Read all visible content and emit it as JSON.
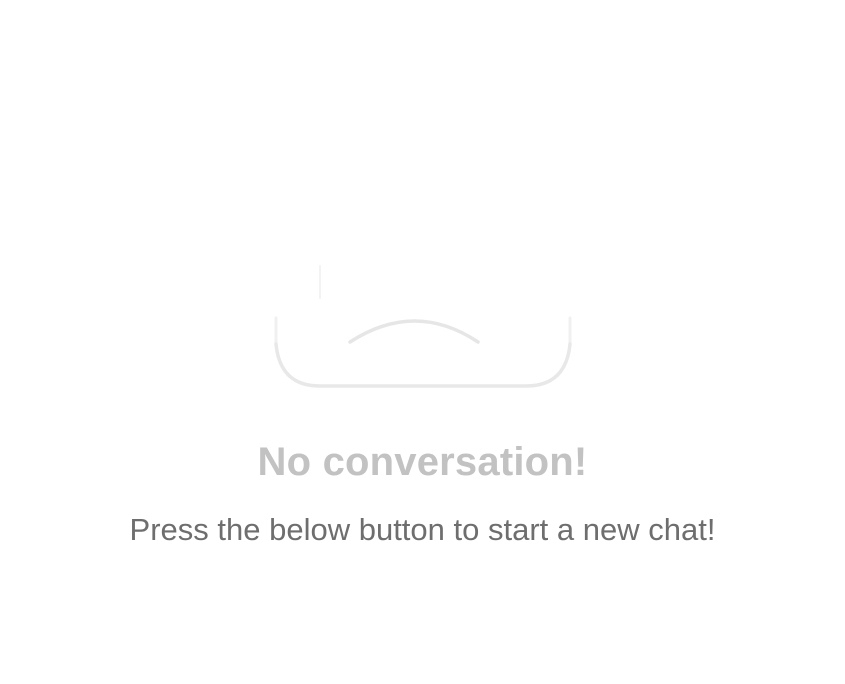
{
  "empty_state": {
    "illustration_icon": "empty-tray-icon",
    "title": "No conversation!",
    "subtitle": "Press the below button to start a new chat!"
  },
  "colors": {
    "background": "#ffffff",
    "title": "#c2c2c2",
    "subtitle": "#6e6e6e",
    "illustration_stroke": "#e6e6e6"
  }
}
